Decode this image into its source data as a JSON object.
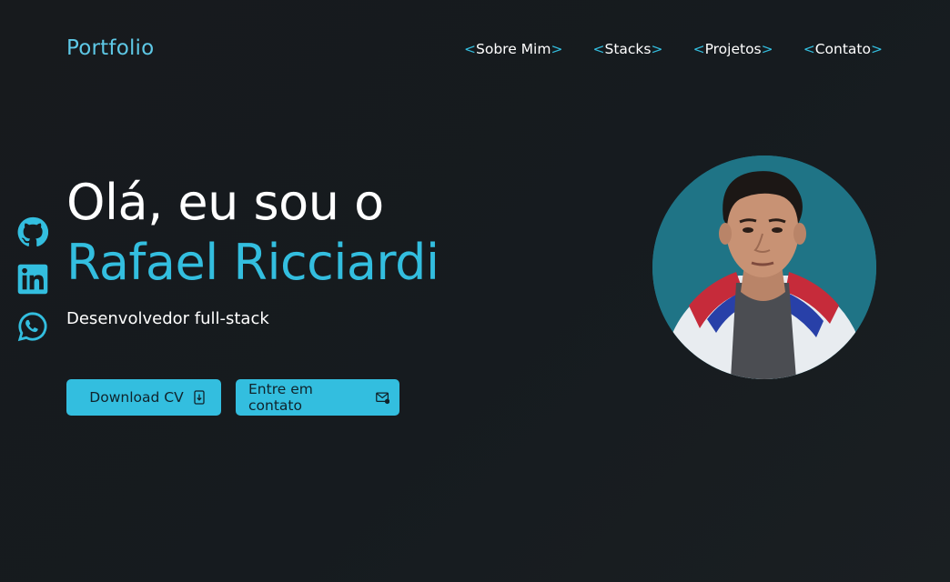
{
  "header": {
    "logo": "Portfolio",
    "nav": [
      {
        "open": "<",
        "label": "Sobre Mim",
        "close": ">"
      },
      {
        "open": "<",
        "label": "Stacks",
        "close": ">"
      },
      {
        "open": "<",
        "label": "Projetos",
        "close": ">"
      },
      {
        "open": "<",
        "label": "Contato",
        "close": ">"
      }
    ]
  },
  "hero": {
    "greeting": "Olá, eu sou o",
    "name": "Rafael Ricciardi",
    "role": "Desenvolvedor full-stack"
  },
  "buttons": {
    "download_cv": "Download CV",
    "contact": "Entre em contato"
  },
  "social": [
    {
      "name": "github-icon"
    },
    {
      "name": "linkedin-icon"
    },
    {
      "name": "whatsapp-icon"
    }
  ],
  "colors": {
    "accent": "#33bedf",
    "logo": "#5ec8e6",
    "background": "#171a1d",
    "avatar_bg": "#1f7486"
  }
}
